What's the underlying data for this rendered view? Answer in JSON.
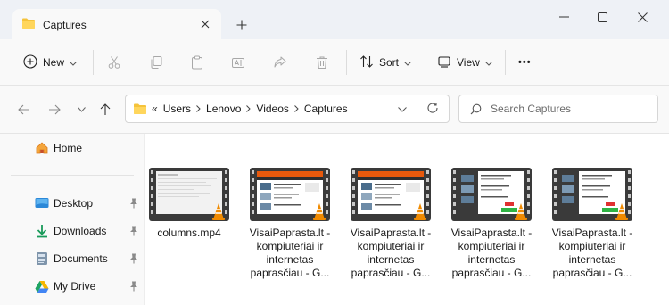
{
  "window": {
    "tab_title": "Captures",
    "new_tab_symbol": "+",
    "icons": {
      "tab": "folder-icon",
      "minimize": "minimize-icon",
      "maximize": "maximize-icon",
      "close": "close-icon"
    }
  },
  "toolbar": {
    "new_label": "New",
    "sort_label": "Sort",
    "view_label": "View",
    "more_label": "•••",
    "icons": [
      "cut-icon",
      "copy-icon",
      "paste-icon",
      "rename-icon",
      "share-icon",
      "delete-icon"
    ]
  },
  "address": {
    "overflow_symbol": "«",
    "breadcrumbs": [
      "Users",
      "Lenovo",
      "Videos",
      "Captures"
    ]
  },
  "search": {
    "placeholder": "Search Captures"
  },
  "sidebar": {
    "items": [
      {
        "label": "Home",
        "icon": "home-icon"
      },
      {
        "label": "Desktop",
        "icon": "desktop-icon",
        "pinned": true
      },
      {
        "label": "Downloads",
        "icon": "download-icon",
        "pinned": true
      },
      {
        "label": "Documents",
        "icon": "documents-icon",
        "pinned": true
      },
      {
        "label": "My Drive",
        "icon": "google-drive-icon",
        "pinned": true
      }
    ]
  },
  "files": [
    {
      "lines": [
        "columns.mp4"
      ],
      "thumbnail": "plain-document"
    },
    {
      "lines": [
        "VisaiPaprasta.lt -",
        "kompiuteriai ir",
        "internetas",
        "paprasčiau - G..."
      ],
      "thumbnail": "website-orange-header"
    },
    {
      "lines": [
        "VisaiPaprasta.lt -",
        "kompiuteriai ir",
        "internetas",
        "paprasčiau - G..."
      ],
      "thumbnail": "website-orange-header"
    },
    {
      "lines": [
        "VisaiPaprasta.lt -",
        "kompiuteriai ir",
        "internetas",
        "paprasčiau - G..."
      ],
      "thumbnail": "website-dark-list"
    },
    {
      "lines": [
        "VisaiPaprasta.lt -",
        "kompiuteriai ir",
        "internetas",
        "paprasčiau - G..."
      ],
      "thumbnail": "website-dark-list"
    }
  ],
  "colors": {
    "accent": "#0067c0",
    "folder": "#f5c33b",
    "vlc": "#f08a00",
    "film": "#3a3a3a"
  }
}
